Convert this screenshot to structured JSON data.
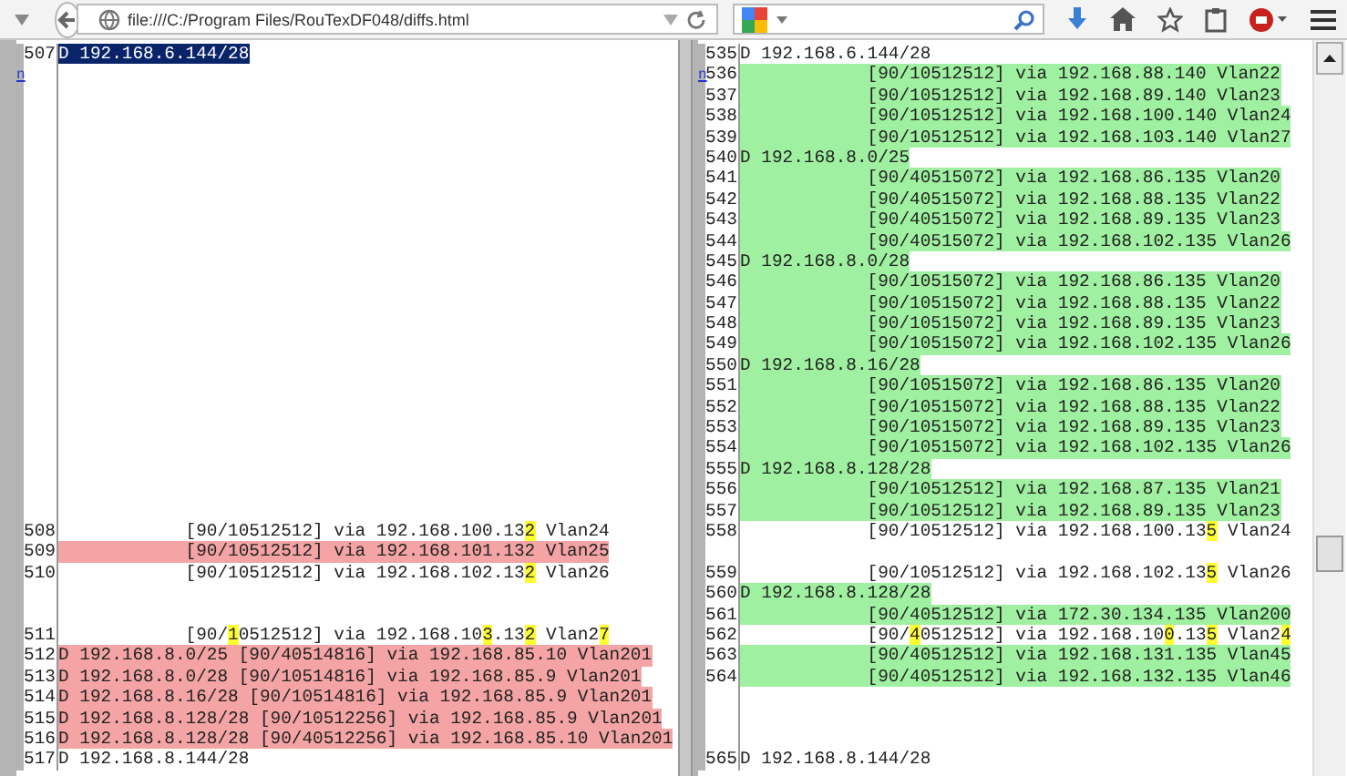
{
  "browser": {
    "url": "file:///C:/Program Files/RouTexDF048/diffs.html"
  },
  "panes": [
    {
      "rows": [
        {
          "num": "507",
          "kind": "same",
          "selected": true,
          "text": "D 192.168.6.144/28"
        },
        {
          "kind": "blank",
          "anchor": "n"
        },
        {
          "kind": "blank"
        },
        {
          "kind": "blank"
        },
        {
          "kind": "blank"
        },
        {
          "kind": "blank"
        },
        {
          "kind": "blank"
        },
        {
          "kind": "blank"
        },
        {
          "kind": "blank"
        },
        {
          "kind": "blank"
        },
        {
          "kind": "blank"
        },
        {
          "kind": "blank"
        },
        {
          "kind": "blank"
        },
        {
          "kind": "blank"
        },
        {
          "kind": "blank"
        },
        {
          "kind": "blank"
        },
        {
          "kind": "blank"
        },
        {
          "kind": "blank"
        },
        {
          "kind": "blank"
        },
        {
          "kind": "blank"
        },
        {
          "kind": "blank"
        },
        {
          "kind": "blank"
        },
        {
          "kind": "blank"
        },
        {
          "num": "508",
          "kind": "same",
          "selected": false,
          "parts": [
            {
              "text": "            [90/10512512] via 192.168.100.13",
              "changed": false
            },
            {
              "text": "2",
              "changed": true
            },
            {
              "text": " Vlan24",
              "changed": false
            }
          ]
        },
        {
          "num": "509",
          "kind": "removed",
          "selected": false,
          "text": "            [90/10512512] via 192.168.101.132 Vlan25"
        },
        {
          "num": "510",
          "kind": "same",
          "selected": false,
          "parts": [
            {
              "text": "            [90/10512512] via 192.168.102.13",
              "changed": false
            },
            {
              "text": "2",
              "changed": true
            },
            {
              "text": " Vlan26",
              "changed": false
            }
          ]
        },
        {
          "kind": "blank"
        },
        {
          "kind": "blank"
        },
        {
          "num": "511",
          "kind": "same",
          "selected": false,
          "parts": [
            {
              "text": "            [90/",
              "changed": false
            },
            {
              "text": "1",
              "changed": true
            },
            {
              "text": "0512512] via 192.168.10",
              "changed": false
            },
            {
              "text": "3",
              "changed": true
            },
            {
              "text": ".13",
              "changed": false
            },
            {
              "text": "2",
              "changed": true
            },
            {
              "text": " Vlan2",
              "changed": false
            },
            {
              "text": "7",
              "changed": true
            }
          ]
        },
        {
          "num": "512",
          "kind": "removed",
          "selected": false,
          "text": "D 192.168.8.0/25 [90/40514816] via 192.168.85.10 Vlan201"
        },
        {
          "num": "513",
          "kind": "removed",
          "selected": false,
          "text": "D 192.168.8.0/28 [90/10514816] via 192.168.85.9 Vlan201"
        },
        {
          "num": "514",
          "kind": "removed",
          "selected": false,
          "text": "D 192.168.8.16/28 [90/10514816] via 192.168.85.9 Vlan201"
        },
        {
          "num": "515",
          "kind": "removed",
          "selected": false,
          "text": "D 192.168.8.128/28 [90/10512256] via 192.168.85.9 Vlan201"
        },
        {
          "num": "516",
          "kind": "removed",
          "selected": false,
          "text": "D 192.168.8.128/28 [90/40512256] via 192.168.85.10 Vlan201"
        },
        {
          "num": "517",
          "kind": "same",
          "selected": false,
          "text": "D 192.168.8.144/28"
        }
      ]
    },
    {
      "rows": [
        {
          "num": "535",
          "kind": "same",
          "selected": false,
          "text": "D 192.168.6.144/28"
        },
        {
          "num": "536",
          "kind": "added",
          "selected": false,
          "anchor": "n",
          "text": "            [90/10512512] via 192.168.88.140 Vlan22"
        },
        {
          "num": "537",
          "kind": "added",
          "selected": false,
          "text": "            [90/10512512] via 192.168.89.140 Vlan23"
        },
        {
          "num": "538",
          "kind": "added",
          "selected": false,
          "text": "            [90/10512512] via 192.168.100.140 Vlan24"
        },
        {
          "num": "539",
          "kind": "added",
          "selected": false,
          "text": "            [90/10512512] via 192.168.103.140 Vlan27"
        },
        {
          "num": "540",
          "kind": "added",
          "selected": false,
          "text": "D 192.168.8.0/25"
        },
        {
          "num": "541",
          "kind": "added",
          "selected": false,
          "text": "            [90/40515072] via 192.168.86.135 Vlan20"
        },
        {
          "num": "542",
          "kind": "added",
          "selected": false,
          "text": "            [90/40515072] via 192.168.88.135 Vlan22"
        },
        {
          "num": "543",
          "kind": "added",
          "selected": false,
          "text": "            [90/40515072] via 192.168.89.135 Vlan23"
        },
        {
          "num": "544",
          "kind": "added",
          "selected": false,
          "text": "            [90/40515072] via 192.168.102.135 Vlan26"
        },
        {
          "num": "545",
          "kind": "added",
          "selected": false,
          "text": "D 192.168.8.0/28"
        },
        {
          "num": "546",
          "kind": "added",
          "selected": false,
          "text": "            [90/10515072] via 192.168.86.135 Vlan20"
        },
        {
          "num": "547",
          "kind": "added",
          "selected": false,
          "text": "            [90/10515072] via 192.168.88.135 Vlan22"
        },
        {
          "num": "548",
          "kind": "added",
          "selected": false,
          "text": "            [90/10515072] via 192.168.89.135 Vlan23"
        },
        {
          "num": "549",
          "kind": "added",
          "selected": false,
          "text": "            [90/10515072] via 192.168.102.135 Vlan26"
        },
        {
          "num": "550",
          "kind": "added",
          "selected": false,
          "text": "D 192.168.8.16/28"
        },
        {
          "num": "551",
          "kind": "added",
          "selected": false,
          "text": "            [90/10515072] via 192.168.86.135 Vlan20"
        },
        {
          "num": "552",
          "kind": "added",
          "selected": false,
          "text": "            [90/10515072] via 192.168.88.135 Vlan22"
        },
        {
          "num": "553",
          "kind": "added",
          "selected": false,
          "text": "            [90/10515072] via 192.168.89.135 Vlan23"
        },
        {
          "num": "554",
          "kind": "added",
          "selected": false,
          "text": "            [90/10515072] via 192.168.102.135 Vlan26"
        },
        {
          "num": "555",
          "kind": "added",
          "selected": false,
          "text": "D 192.168.8.128/28"
        },
        {
          "num": "556",
          "kind": "added",
          "selected": false,
          "text": "            [90/10512512] via 192.168.87.135 Vlan21"
        },
        {
          "num": "557",
          "kind": "added",
          "selected": false,
          "text": "            [90/10512512] via 192.168.89.135 Vlan23"
        },
        {
          "num": "558",
          "kind": "same",
          "selected": false,
          "parts": [
            {
              "text": "            [90/10512512] via 192.168.100.13",
              "changed": false
            },
            {
              "text": "5",
              "changed": true
            },
            {
              "text": " Vlan24",
              "changed": false
            }
          ]
        },
        {
          "kind": "blank"
        },
        {
          "num": "559",
          "kind": "same",
          "selected": false,
          "parts": [
            {
              "text": "            [90/10512512] via 192.168.102.13",
              "changed": false
            },
            {
              "text": "5",
              "changed": true
            },
            {
              "text": " Vlan26",
              "changed": false
            }
          ]
        },
        {
          "num": "560",
          "kind": "added",
          "selected": false,
          "text": "D 192.168.8.128/28"
        },
        {
          "num": "561",
          "kind": "added",
          "selected": false,
          "text": "            [90/40512512] via 172.30.134.135 Vlan200"
        },
        {
          "num": "562",
          "kind": "same",
          "selected": false,
          "parts": [
            {
              "text": "            [90/",
              "changed": false
            },
            {
              "text": "4",
              "changed": true
            },
            {
              "text": "0512512] via 192.168.10",
              "changed": false
            },
            {
              "text": "0",
              "changed": true
            },
            {
              "text": ".13",
              "changed": false
            },
            {
              "text": "5",
              "changed": true
            },
            {
              "text": " Vlan2",
              "changed": false
            },
            {
              "text": "4",
              "changed": true
            }
          ]
        },
        {
          "num": "563",
          "kind": "added",
          "selected": false,
          "text": "            [90/40512512] via 192.168.131.135 Vlan45"
        },
        {
          "num": "564",
          "kind": "added",
          "selected": false,
          "text": "            [90/40512512] via 192.168.132.135 Vlan46"
        },
        {
          "kind": "blank"
        },
        {
          "kind": "blank"
        },
        {
          "kind": "blank"
        },
        {
          "num": "565",
          "kind": "same",
          "selected": false,
          "text": "D 192.168.8.144/28"
        }
      ]
    }
  ]
}
